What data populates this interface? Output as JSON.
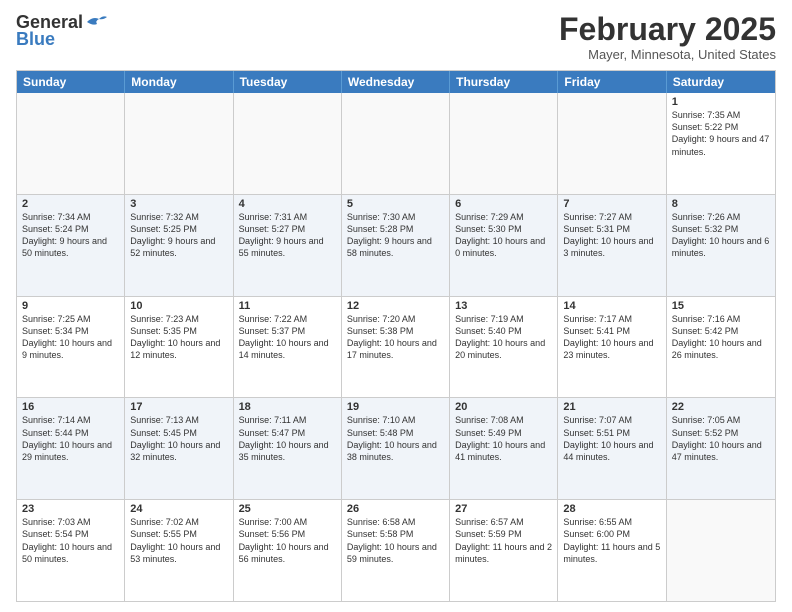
{
  "header": {
    "logo_general": "General",
    "logo_blue": "Blue",
    "month_title": "February 2025",
    "location": "Mayer, Minnesota, United States"
  },
  "weekdays": [
    "Sunday",
    "Monday",
    "Tuesday",
    "Wednesday",
    "Thursday",
    "Friday",
    "Saturday"
  ],
  "rows": [
    [
      {
        "day": "",
        "text": "",
        "empty": true
      },
      {
        "day": "",
        "text": "",
        "empty": true
      },
      {
        "day": "",
        "text": "",
        "empty": true
      },
      {
        "day": "",
        "text": "",
        "empty": true
      },
      {
        "day": "",
        "text": "",
        "empty": true
      },
      {
        "day": "",
        "text": "",
        "empty": true
      },
      {
        "day": "1",
        "text": "Sunrise: 7:35 AM\nSunset: 5:22 PM\nDaylight: 9 hours and 47 minutes.",
        "empty": false
      }
    ],
    [
      {
        "day": "2",
        "text": "Sunrise: 7:34 AM\nSunset: 5:24 PM\nDaylight: 9 hours and 50 minutes.",
        "empty": false
      },
      {
        "day": "3",
        "text": "Sunrise: 7:32 AM\nSunset: 5:25 PM\nDaylight: 9 hours and 52 minutes.",
        "empty": false
      },
      {
        "day": "4",
        "text": "Sunrise: 7:31 AM\nSunset: 5:27 PM\nDaylight: 9 hours and 55 minutes.",
        "empty": false
      },
      {
        "day": "5",
        "text": "Sunrise: 7:30 AM\nSunset: 5:28 PM\nDaylight: 9 hours and 58 minutes.",
        "empty": false
      },
      {
        "day": "6",
        "text": "Sunrise: 7:29 AM\nSunset: 5:30 PM\nDaylight: 10 hours and 0 minutes.",
        "empty": false
      },
      {
        "day": "7",
        "text": "Sunrise: 7:27 AM\nSunset: 5:31 PM\nDaylight: 10 hours and 3 minutes.",
        "empty": false
      },
      {
        "day": "8",
        "text": "Sunrise: 7:26 AM\nSunset: 5:32 PM\nDaylight: 10 hours and 6 minutes.",
        "empty": false
      }
    ],
    [
      {
        "day": "9",
        "text": "Sunrise: 7:25 AM\nSunset: 5:34 PM\nDaylight: 10 hours and 9 minutes.",
        "empty": false
      },
      {
        "day": "10",
        "text": "Sunrise: 7:23 AM\nSunset: 5:35 PM\nDaylight: 10 hours and 12 minutes.",
        "empty": false
      },
      {
        "day": "11",
        "text": "Sunrise: 7:22 AM\nSunset: 5:37 PM\nDaylight: 10 hours and 14 minutes.",
        "empty": false
      },
      {
        "day": "12",
        "text": "Sunrise: 7:20 AM\nSunset: 5:38 PM\nDaylight: 10 hours and 17 minutes.",
        "empty": false
      },
      {
        "day": "13",
        "text": "Sunrise: 7:19 AM\nSunset: 5:40 PM\nDaylight: 10 hours and 20 minutes.",
        "empty": false
      },
      {
        "day": "14",
        "text": "Sunrise: 7:17 AM\nSunset: 5:41 PM\nDaylight: 10 hours and 23 minutes.",
        "empty": false
      },
      {
        "day": "15",
        "text": "Sunrise: 7:16 AM\nSunset: 5:42 PM\nDaylight: 10 hours and 26 minutes.",
        "empty": false
      }
    ],
    [
      {
        "day": "16",
        "text": "Sunrise: 7:14 AM\nSunset: 5:44 PM\nDaylight: 10 hours and 29 minutes.",
        "empty": false
      },
      {
        "day": "17",
        "text": "Sunrise: 7:13 AM\nSunset: 5:45 PM\nDaylight: 10 hours and 32 minutes.",
        "empty": false
      },
      {
        "day": "18",
        "text": "Sunrise: 7:11 AM\nSunset: 5:47 PM\nDaylight: 10 hours and 35 minutes.",
        "empty": false
      },
      {
        "day": "19",
        "text": "Sunrise: 7:10 AM\nSunset: 5:48 PM\nDaylight: 10 hours and 38 minutes.",
        "empty": false
      },
      {
        "day": "20",
        "text": "Sunrise: 7:08 AM\nSunset: 5:49 PM\nDaylight: 10 hours and 41 minutes.",
        "empty": false
      },
      {
        "day": "21",
        "text": "Sunrise: 7:07 AM\nSunset: 5:51 PM\nDaylight: 10 hours and 44 minutes.",
        "empty": false
      },
      {
        "day": "22",
        "text": "Sunrise: 7:05 AM\nSunset: 5:52 PM\nDaylight: 10 hours and 47 minutes.",
        "empty": false
      }
    ],
    [
      {
        "day": "23",
        "text": "Sunrise: 7:03 AM\nSunset: 5:54 PM\nDaylight: 10 hours and 50 minutes.",
        "empty": false
      },
      {
        "day": "24",
        "text": "Sunrise: 7:02 AM\nSunset: 5:55 PM\nDaylight: 10 hours and 53 minutes.",
        "empty": false
      },
      {
        "day": "25",
        "text": "Sunrise: 7:00 AM\nSunset: 5:56 PM\nDaylight: 10 hours and 56 minutes.",
        "empty": false
      },
      {
        "day": "26",
        "text": "Sunrise: 6:58 AM\nSunset: 5:58 PM\nDaylight: 10 hours and 59 minutes.",
        "empty": false
      },
      {
        "day": "27",
        "text": "Sunrise: 6:57 AM\nSunset: 5:59 PM\nDaylight: 11 hours and 2 minutes.",
        "empty": false
      },
      {
        "day": "28",
        "text": "Sunrise: 6:55 AM\nSunset: 6:00 PM\nDaylight: 11 hours and 5 minutes.",
        "empty": false
      },
      {
        "day": "",
        "text": "",
        "empty": true
      }
    ]
  ]
}
